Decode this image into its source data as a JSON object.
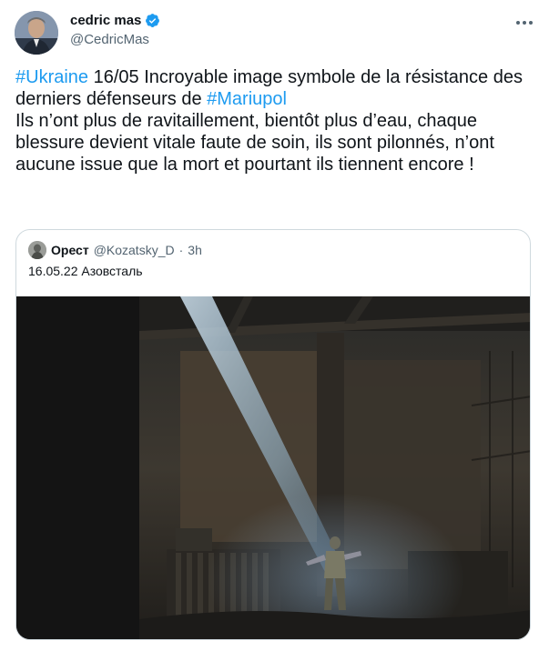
{
  "tweet": {
    "author_name": "cedric mas",
    "author_handle": "@CedricMas",
    "hashtag1": "#Ukraine",
    "text1": " 16/05 Incroyable image symbole de la résistance des derniers défenseurs de ",
    "hashtag2": "#Mariupol",
    "text2": "\nIls n’ont plus de ravitaillement, bientôt plus d’eau, chaque blessure devient vitale faute de soin, ils sont pilonnés, n’ont aucune issue que la mort et pourtant ils tiennent encore !"
  },
  "quoted": {
    "author_name": "Орест",
    "author_handle": "@Kozatsky_D",
    "separator": "·",
    "time": "3h",
    "text": "16.05.22 Азовсталь"
  },
  "icons": [
    "verified-badge-icon",
    "more-options-icon"
  ],
  "colors": {
    "link": "#1d9bf0",
    "secondary_text": "#536471",
    "border": "#cfd9de",
    "verified": "#1d9bf0"
  }
}
